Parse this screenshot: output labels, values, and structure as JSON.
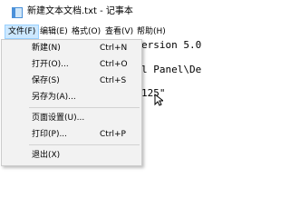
{
  "window": {
    "title": "新建文本文档.txt - 记事本"
  },
  "menubar": [
    {
      "label": "文件(F)",
      "active": true
    },
    {
      "label": "编辑(E)"
    },
    {
      "label": "格式(O)"
    },
    {
      "label": "查看(V)"
    },
    {
      "label": "帮助(H)"
    }
  ],
  "file_menu": {
    "items": [
      {
        "label": "新建(N)",
        "shortcut": "Ctrl+N"
      },
      {
        "label": "打开(O)...",
        "shortcut": "Ctrl+O"
      },
      {
        "label": "保存(S)",
        "shortcut": "Ctrl+S"
      },
      {
        "label": "另存为(A)...",
        "shortcut": ""
      },
      {
        "label": "页面设置(U)...",
        "shortcut": ""
      },
      {
        "label": "打印(P)...",
        "shortcut": "Ctrl+P"
      },
      {
        "label": "退出(X)",
        "shortcut": ""
      }
    ]
  },
  "editor": {
    "lines": [
      "ersion 5.0",
      "l Panel\\De",
      "125\""
    ]
  },
  "colors": {
    "menu_highlight": "#cce8ff",
    "menu_highlight_border": "#99d1ff",
    "dropdown_bg": "#f2f2f2"
  }
}
